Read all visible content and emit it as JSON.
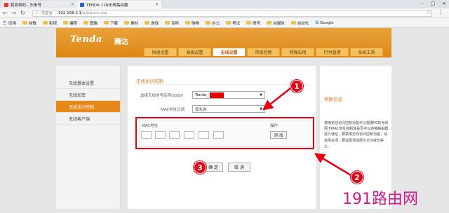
{
  "browser": {
    "tabs": [
      {
        "title": "我发表的 - 头条号",
        "color": "#e53935"
      },
      {
        "title": "TENDA 11N无线路由器",
        "color": "#1e66c7"
      }
    ],
    "address": {
      "security": "不安全",
      "host": "192.168.2.1",
      "path": "/advance.asp"
    },
    "bookmarks": [
      "应用",
      "谷歌",
      "影视",
      "编程",
      "图像",
      "下载",
      "素材",
      "游戏",
      "百科",
      "购物",
      "办公",
      "考试",
      "账号",
      "自媒体",
      "自动化",
      "Google"
    ]
  },
  "router": {
    "logo": "Tenda",
    "logo_cn": "腾达",
    "nav_tabs": [
      "快速设置",
      "高级设置",
      "无线设置",
      "带宽控制",
      "特殊应用",
      "行为管理",
      "系统工具"
    ],
    "active_nav": 2,
    "sidebar": [
      "无线基本设置",
      "无线加密",
      "无线访问控制",
      "无线客户端"
    ],
    "active_side": 2,
    "section_title": "无线访问控制",
    "form": {
      "ssid_label": "选择无线信号名称(SSID)",
      "ssid_value": "Tenda_",
      "mac_filter_label": "MAC地址过滤",
      "mac_filter_value": "仅允许",
      "mac_header": "MAC地址",
      "op_header": "操作",
      "add_button": "添 加"
    },
    "confirm_button": "确 定",
    "cancel_button": "取 消",
    "help": {
      "title": "帮助信息",
      "body": "使用无线访问控制功能可以根据PC的无线网卡MAC地址控制其是否可以连接路由器进行通信，要禁用无线访问控制功能，请选择关闭，要设置请选择仅允许或仅禁止。"
    }
  },
  "annotations": {
    "markers": [
      "1",
      "2",
      "3"
    ],
    "accent": "#e60012"
  },
  "watermark": "191路由网"
}
